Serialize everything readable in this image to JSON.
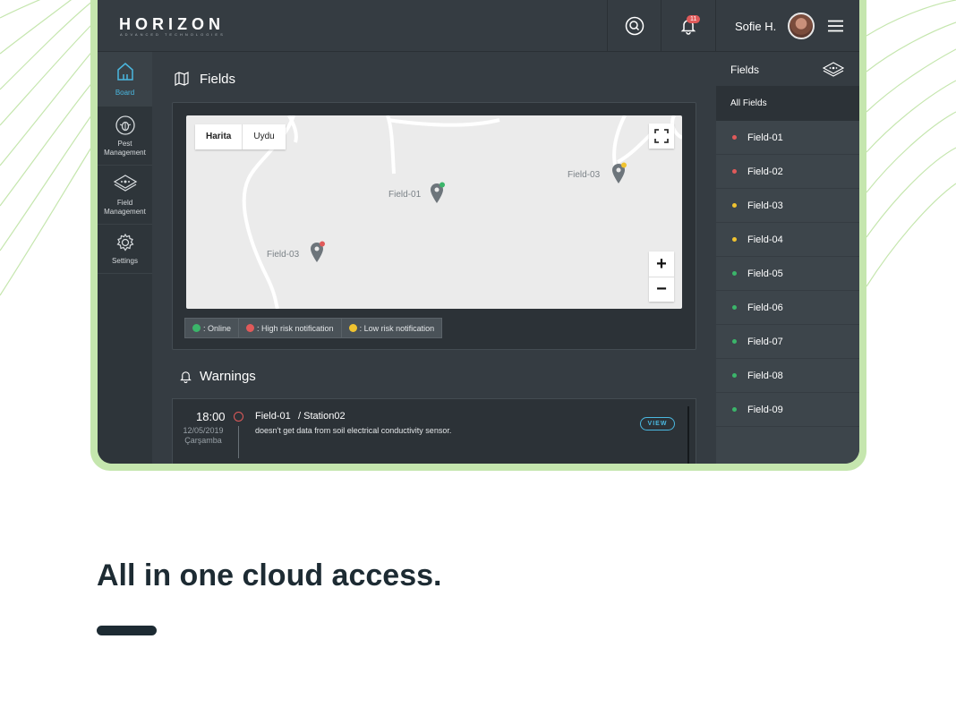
{
  "colors": {
    "accent": "#4ab8e0",
    "online": "#3bb56a",
    "high_risk": "#e05a5a",
    "low_risk": "#f0c330",
    "dark": "#1d2b33"
  },
  "header": {
    "logo": "HORIZON",
    "logo_subtitle": "ADVANCED TECHNOLOGIES",
    "notification_count": "11",
    "user_name": "Sofie H."
  },
  "sidebar": {
    "items": [
      {
        "label": "Board",
        "icon": "home-icon"
      },
      {
        "label": "Pest Management",
        "icon": "bug-icon"
      },
      {
        "label": "Field Management",
        "icon": "field-icon"
      },
      {
        "label": "Settings",
        "icon": "gear-icon"
      }
    ]
  },
  "main": {
    "fields_title": "Fields",
    "map": {
      "toggle": [
        "Harita",
        "Uydu"
      ],
      "pins": [
        {
          "label": "Field-01",
          "status": "online"
        },
        {
          "label": "Field-03",
          "status": "low_risk"
        },
        {
          "label": "Field-03",
          "status": "high_risk"
        }
      ],
      "zoom_in": "+",
      "zoom_out": "−"
    },
    "legend": [
      {
        "label": ": Online",
        "status": "online"
      },
      {
        "label": ": High risk notification",
        "status": "high_risk"
      },
      {
        "label": ": Low risk notification",
        "status": "low_risk"
      }
    ],
    "warnings_title": "Warnings",
    "warning": {
      "time": "18:00",
      "date": "12/05/2019",
      "day": "Çarşamba",
      "field": "Field-01",
      "station": "/ Station02",
      "message": "doesn't get data from soil electrical conductivity sensor.",
      "action": "VIEW"
    }
  },
  "fields_panel": {
    "title": "Fields",
    "all": "All Fields",
    "items": [
      {
        "label": "Field-01",
        "status": "high_risk"
      },
      {
        "label": "Field-02",
        "status": "high_risk"
      },
      {
        "label": "Field-03",
        "status": "low_risk"
      },
      {
        "label": "Field-04",
        "status": "low_risk"
      },
      {
        "label": "Field-05",
        "status": "online"
      },
      {
        "label": "Field-06",
        "status": "online"
      },
      {
        "label": "Field-07",
        "status": "online"
      },
      {
        "label": "Field-08",
        "status": "online"
      },
      {
        "label": "Field-09",
        "status": "online"
      }
    ]
  },
  "tagline": "All in one cloud access."
}
